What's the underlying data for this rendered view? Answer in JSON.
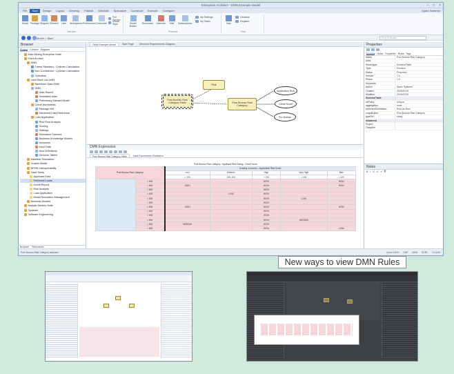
{
  "window": {
    "title": "Enterprise Architect - DMN Example Model",
    "controls": [
      "–",
      "□",
      "×"
    ]
  },
  "menu": {
    "items": [
      "File",
      "Start",
      "Design",
      "Layout",
      "Develop",
      "Publish",
      "Simulate",
      "Specialize",
      "Construct",
      "Execute",
      "Configure"
    ],
    "active_index": 1,
    "account": "Sparx Systems"
  },
  "ribbon": {
    "groups": [
      {
        "label": "Interface",
        "buttons": [
          "Model",
          "Package",
          "Diagram",
          "Element",
          "Lists",
          "Workspaces",
          "Preferences",
          "Customize"
        ]
      },
      {
        "label": "Personal",
        "buttons": [
          "Model Builder",
          "Resources",
          "Calendar",
          "Mail",
          "Subscriptions",
          "Help"
        ]
      },
      {
        "label": "Help",
        "buttons": [
          "Help",
          "Libraries",
          "Register"
        ]
      }
    ],
    "small_buttons": [
      "Full Screen",
      "Visual Style",
      "My Settings",
      "My Tasks"
    ]
  },
  "address": {
    "crumb": "Model > Start",
    "search_placeholder": "Find in Model"
  },
  "browser": {
    "title": "Browser",
    "tabs": [
      "Project",
      "Context",
      "Diagram"
    ],
    "bottom_tabs": [
      "Browser",
      "Resources"
    ],
    "tree": [
      "Data Mining Enterprise Suite",
      "Feed Archive",
      "DMN",
      "Forest Standard - Cylinder Calculation",
      "Non-Confidence - Cylinder Calculation",
      "Operation",
      "Joint Stock Ltd DMN",
      "Backbone Data DMN",
      "DMN",
      "Data Stored",
      "Simulation data",
      "Preliminary Dataset Model",
      "Credit Worthiness",
      "Package Ref",
      "Hardened Data Reference",
      "Loan Application",
      "Risk Flow Analysis",
      "Scoring",
      "Settings",
      "Simulation Sources",
      "Business Knowledge Models",
      "Decisions",
      "Input Data",
      "Item Definitions",
      "Decision Tables",
      "Dataflow Simulation",
      "Graphs Model",
      "BPMN Interoperability",
      "Case Study",
      "Applicant Data",
      "Preferred Loans",
      "Credit Report",
      "Risk Analysis",
      "Loan Application",
      "Model Simulation Management",
      "Business Models",
      "Analytic Models Suite",
      "Systems",
      "Software Engineering"
    ],
    "selected_index": 30
  },
  "center": {
    "tabs": [
      "DMN Example Model",
      "Start Page",
      "Decision Requirements Diagram"
    ],
    "active_tab": 0,
    "diagram": {
      "nodes": [
        {
          "id": "input",
          "label": "Risk"
        },
        {
          "id": "selected",
          "label": "Post Bureau Risk Category Table"
        },
        {
          "id": "decision",
          "label": "Post Bureau Risk Category"
        },
        {
          "id": "bkm1",
          "label": "Application Risk"
        },
        {
          "id": "bkm2",
          "label": "Credit Score"
        },
        {
          "id": "bkm3",
          "label": "Pre-Bureau"
        }
      ]
    }
  },
  "dmn": {
    "title": "DMN Expression",
    "tabs": [
      "Post Bureau Risk Category Table",
      "Input Expressions Simulation"
    ],
    "table_title": "Post Bureau Risk Category - Applicant Risk Rating - Credit Score",
    "header_group": "Existing Customer - Application Risk Score",
    "rowhead": "Post Bureau Risk Category",
    "columns": [
      "Low",
      "Medium",
      "High",
      "Very High",
      "Max"
    ],
    "ranges": [
      "< 100",
      "100..120",
      "> 120",
      "< 100",
      "> 120"
    ],
    "rows": [
      {
        "key": "> 600",
        "cells": [
          "",
          "",
          "HIGH",
          "",
          "HIGH"
        ]
      },
      {
        "key": "> 600",
        "cells": [
          "HIGH",
          "",
          "HIGH",
          "",
          "HIGH"
        ]
      },
      {
        "key": "> 600",
        "cells": [
          "",
          "",
          "HIGH",
          "",
          ""
        ]
      },
      {
        "key": "> 600",
        "cells": [
          "",
          "LOW",
          "HIGH",
          "",
          ""
        ]
      },
      {
        "key": "> 600",
        "cells": [
          "",
          "",
          "HIGH",
          "LOW",
          ""
        ]
      },
      {
        "key": "> 600",
        "cells": [
          "",
          "",
          "HIGH",
          "",
          ""
        ]
      },
      {
        "key": "> 600",
        "cells": [
          "HIGH",
          "",
          "HIGH",
          "",
          "HIGH"
        ]
      },
      {
        "key": "> 600",
        "cells": [
          "",
          "",
          "HIGH",
          "",
          ""
        ]
      },
      {
        "key": "> 600",
        "cells": [
          "",
          "",
          "HIGH",
          "",
          ""
        ]
      },
      {
        "key": "> 600",
        "cells": [
          "",
          "",
          "HIGH",
          "MEDIUM",
          ""
        ]
      },
      {
        "key": "> 600",
        "cells": [
          "MEDIUM",
          "",
          "HIGH",
          "",
          ""
        ]
      },
      {
        "key": "> 600",
        "cells": [
          "",
          "",
          "HIGH",
          "",
          "LOW"
        ]
      }
    ]
  },
  "properties": {
    "title": "Properties",
    "tabs": [
      "Element",
      "Notes",
      "Properties",
      "Rules",
      "Tags"
    ],
    "rows": [
      {
        "k": "Name",
        "v": "Post Bureau Risk Category"
      },
      {
        "k": "Alias",
        "v": ""
      },
      {
        "k": "Stereotype",
        "v": "DecisionTable"
      },
      {
        "k": "Type",
        "v": "Decision"
      },
      {
        "k": "Status",
        "v": "Proposed"
      },
      {
        "k": "Version",
        "v": "1.0"
      },
      {
        "k": "Phase",
        "v": "1.0"
      },
      {
        "k": "Keywords",
        "v": ""
      },
      {
        "k": "Author",
        "v": "Sparx Systems"
      },
      {
        "k": "Created",
        "v": "23/04/2019"
      },
      {
        "k": "Modified",
        "v": "23/04/2019"
      },
      {
        "k": "DecisionTable",
        "v": ""
      },
      {
        "k": "hitPolicy",
        "v": "Unique"
      },
      {
        "k": "aggregation",
        "v": "none"
      },
      {
        "k": "preferredOrientation",
        "v": "Rule-as-Row"
      },
      {
        "k": "outputLabel",
        "v": "Post Bureau Risk Category"
      },
      {
        "k": "typeRef",
        "v": "string"
      },
      {
        "k": "Advanced",
        "v": ""
      },
      {
        "k": "Project",
        "v": ""
      },
      {
        "k": "Classifier",
        "v": ""
      }
    ],
    "notes_title": "Notes"
  },
  "status": {
    "left": "Post Bureau Risk Category selected",
    "items": [
      "Zoom 100%",
      "CAP",
      "NUM",
      "SCRL",
      "CLOUD"
    ]
  },
  "caption": "New ways to view DMN Rules"
}
